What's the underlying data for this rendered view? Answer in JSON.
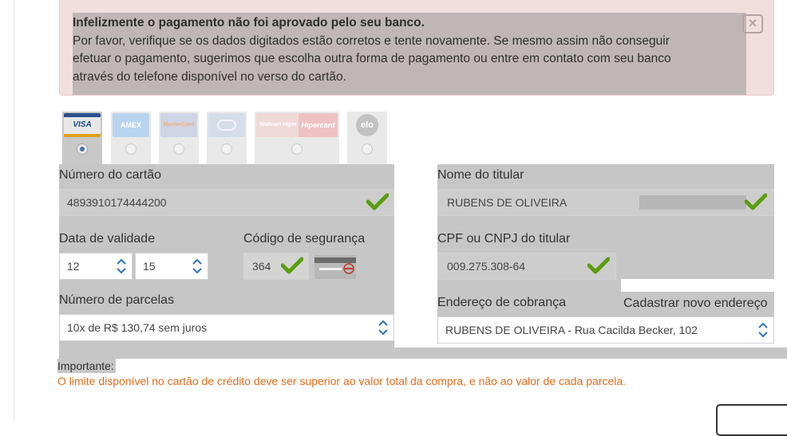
{
  "alert": {
    "title": "Infelizmente o pagamento não foi aprovado pelo seu banco.",
    "line1": "Por favor, verifique se os dados digitados estão corretos e tente novamente. Se mesmo assim não conseguir",
    "line2": "efetuar o pagamento, sugerimos que escolha outra forma de pagamento ou entre em contato com seu banco",
    "line3": "através do telefone disponível no verso do cartão.",
    "close_icon": "close-icon"
  },
  "brands": [
    {
      "name": "VISA",
      "selected": true,
      "color": "#1a4a8c"
    },
    {
      "name": "AMEX",
      "selected": false,
      "color": "#5b9bd5"
    },
    {
      "name": "MasterCard",
      "selected": false,
      "color": "#c0392b"
    },
    {
      "name": "Diners",
      "selected": false,
      "color": "#2c6aa0"
    },
    {
      "name": "Walmart Hiper",
      "selected": false,
      "color": "#c62828"
    },
    {
      "name": "Hipercard",
      "selected": false,
      "color": "#b71c1c"
    },
    {
      "name": "elo",
      "selected": false,
      "color": "#222222"
    }
  ],
  "card": {
    "number_label": "Número do cartão",
    "number_value": "4893910174444200",
    "expiry_label": "Data de validade",
    "expiry_month": "12",
    "expiry_year": "15",
    "cvv_label": "Código de segurança",
    "cvv_value": "364",
    "installments_label": "Número de parcelas",
    "installments_value": "10x de R$ 130,74 sem juros"
  },
  "holder": {
    "name_label": "Nome do titular",
    "name_value": "RUBENS DE OLIVEIRA",
    "doc_label": "CPF ou CNPJ do titular",
    "doc_value": "009.275.308-64",
    "address_label": "Endereço de cobrança",
    "new_address_link": "Cadastrar novo endereço",
    "address_value": "RUBENS DE OLIVEIRA - Rua Cacilda Becker, 102"
  },
  "notice": {
    "label": "Importante:",
    "text": "O limite disponível no cartão de crédito deve ser superior ao valor total da compra, e não ao valor de cada parcela."
  },
  "colors": {
    "alert_bg": "#f2dede",
    "valid_check": "#5a9e0f",
    "warning_text": "#e26d1b"
  }
}
